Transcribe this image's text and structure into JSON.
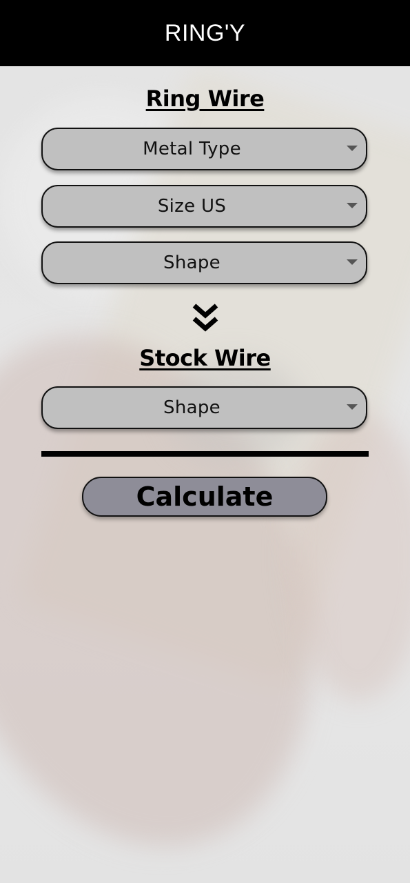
{
  "app": {
    "title": "RING'Y"
  },
  "ring_wire": {
    "heading": "Ring Wire",
    "dropdowns": [
      {
        "label": "Metal Type"
      },
      {
        "label": "Size US"
      },
      {
        "label": "Shape"
      }
    ]
  },
  "stock_wire": {
    "heading": "Stock Wire",
    "dropdowns": [
      {
        "label": "Shape"
      }
    ]
  },
  "actions": {
    "calculate_label": "Calculate"
  },
  "icons": {
    "dropdown_caret": "caret-down-icon",
    "arrow": "double-chevron-down-icon"
  },
  "colors": {
    "header_bg": "#000000",
    "dropdown_bg": "#c0c0c0",
    "button_bg": "#8e8d98"
  }
}
